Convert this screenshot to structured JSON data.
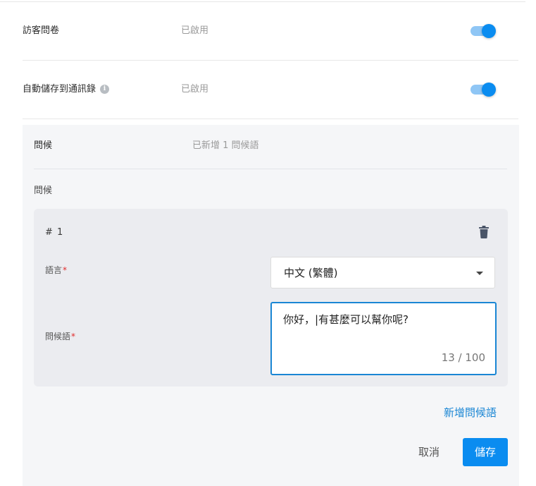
{
  "settings": [
    {
      "label": "訪客問卷",
      "status": "已啟用",
      "enabled": true
    },
    {
      "label": "自動儲存到通訊錄",
      "status": "已啟用",
      "enabled": true,
      "info_icon": "info-icon"
    }
  ],
  "greeting": {
    "label": "問候",
    "status": "已新增 1 問候語",
    "section_label": "問候",
    "items": [
      {
        "number": "# 1",
        "language_label": "語言",
        "language_value": "中文 (繁體)",
        "greeting_label": "問候語",
        "greeting_text": "你好，|有甚麼可以幫你呢?",
        "counter": "13 / 100"
      }
    ],
    "required_mark": "*",
    "add_label": "新增問候語"
  },
  "actions": {
    "cancel_label": "取消",
    "save_label": "儲存"
  },
  "colors": {
    "accent": "#0a8cf0",
    "link": "#1a86d4",
    "required": "#e02b2b"
  }
}
